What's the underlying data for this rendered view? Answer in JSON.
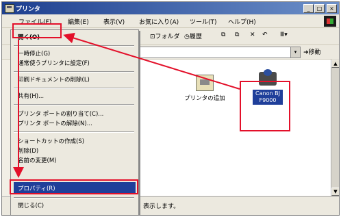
{
  "window": {
    "title": "プリンタ",
    "btn_min": "_",
    "btn_max": "□",
    "btn_close": "×"
  },
  "menubar": {
    "file": "ファイル(F)",
    "edit": "編集(E)",
    "view": "表示(V)",
    "favorites": "お気に入り(A)",
    "tools": "ツール(T)",
    "help": "ヘルプ(H)"
  },
  "toolbar": {
    "folders": "フォルダ",
    "history": "履歴",
    "views": "Ⅲ▾"
  },
  "address": {
    "go": "移動",
    "dropdown": "▾"
  },
  "file_menu": {
    "items": [
      "開く(O)",
      "一時停止(G)",
      "通常使うプリンタに設定(F)",
      "印刷ドキュメントの削除(L)",
      "共有(H)...",
      "プリンタ ポートの割り当て(C)...",
      "プリンタ ポートの解除(N)...",
      "ショートカットの作成(S)",
      "削除(D)",
      "名前の変更(M)",
      "プロパティ(R)",
      "閉じる(C)"
    ]
  },
  "content": {
    "add_printer": "プリンタの追加",
    "printer_name_1": "Canon BJ",
    "printer_name_2": "F9000"
  },
  "status": {
    "text": "表示します。"
  },
  "scroll": {
    "up": "▲",
    "down": "▼"
  },
  "colors": {
    "highlight": "#e3102a",
    "selection": "#1f3f9a",
    "titlebar": "#1d3f8f"
  }
}
